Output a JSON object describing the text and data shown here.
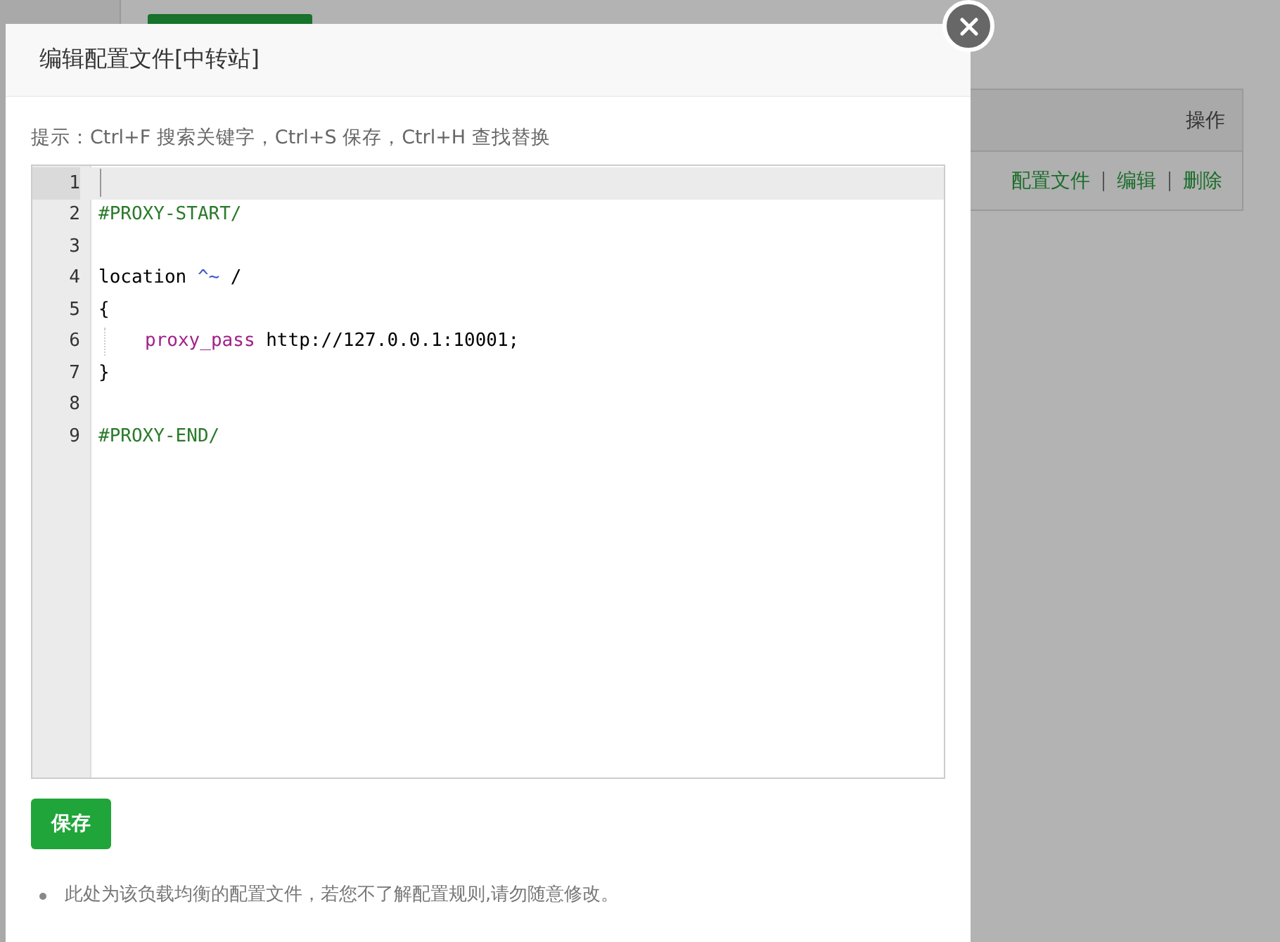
{
  "page": {
    "table": {
      "columns": [
        "操作"
      ],
      "rows": [
        {
          "actions": [
            "配置文件",
            "编辑",
            "删除"
          ]
        }
      ]
    }
  },
  "dialog": {
    "title": "编辑配置文件[中转站]",
    "hint": "提示：Ctrl+F 搜索关键字，Ctrl+S 保存，Ctrl+H 查找替换",
    "editor": {
      "lines": [
        {
          "number": "1",
          "active": true
        },
        {
          "number": "2",
          "active": false,
          "tokens": [
            {
              "kind": "comment",
              "text": "#PROXY-START/"
            }
          ]
        },
        {
          "number": "3",
          "active": false
        },
        {
          "number": "4",
          "active": false,
          "tokens": [
            {
              "kind": "plain",
              "text": "location "
            },
            {
              "kind": "operator",
              "text": "^~"
            },
            {
              "kind": "plain",
              "text": " /"
            }
          ]
        },
        {
          "number": "5",
          "active": false,
          "tokens": [
            {
              "kind": "plain",
              "text": "{"
            }
          ]
        },
        {
          "number": "6",
          "active": false,
          "indented": true,
          "tokens": [
            {
              "kind": "property",
              "text": "proxy_pass"
            },
            {
              "kind": "plain",
              "text": " http://127.0.0.1:10001;"
            }
          ]
        },
        {
          "number": "7",
          "active": false,
          "tokens": [
            {
              "kind": "plain",
              "text": "}"
            }
          ]
        },
        {
          "number": "8",
          "active": false
        },
        {
          "number": "9",
          "active": false,
          "tokens": [
            {
              "kind": "comment",
              "text": "#PROXY-END/"
            }
          ]
        }
      ]
    },
    "save_button": "保存",
    "notes": [
      "此处为该负载均衡的配置文件，若您不了解配置规则,请勿随意修改。"
    ]
  }
}
